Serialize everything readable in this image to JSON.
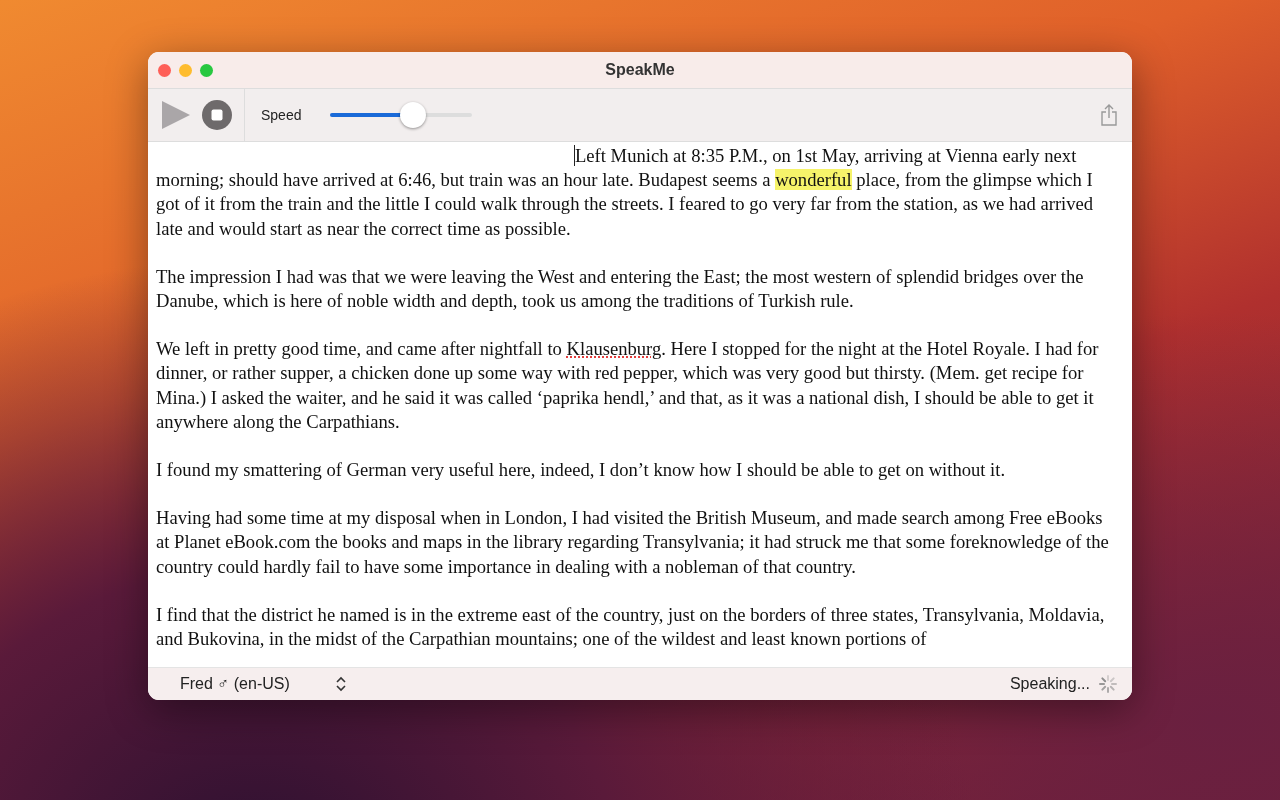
{
  "window": {
    "title": "SpeakMe"
  },
  "toolbar": {
    "speed_label": "Speed",
    "speed": {
      "level": 0.58
    }
  },
  "paragraphs": [
    {
      "kind": "cursor",
      "segments": [
        {
          "kind": "plain",
          "text": "Left Munich at 8:35 P.M., on 1st May, arriving at Vienna early next morning; should have arrived at 6:46, but train was an hour late. Budapest seems a "
        },
        {
          "kind": "highlight",
          "text": "wonderful"
        },
        {
          "kind": "plain",
          "text": " place, from the glimpse which I got of it from the train and the little I could walk through the streets. I feared to go very far from the station, as we had arrived late and would start as near the correct time as possible."
        }
      ]
    },
    {
      "kind": "plain",
      "segments": [
        {
          "kind": "plain",
          "text": "The impression I had was that we were leaving the West and entering the East; the most western of splendid bridges over the Danube, which is here of noble width and depth, took us among the traditions of Turkish rule."
        }
      ]
    },
    {
      "kind": "plain",
      "segments": [
        {
          "kind": "plain",
          "text": "We left in pretty good time, and came after nightfall to "
        },
        {
          "kind": "misspelled",
          "text": "Klausenburg"
        },
        {
          "kind": "plain",
          "text": ". Here I stopped for the night at the Hotel Royale. I had for dinner, or rather supper, a chicken done up some way with red pepper, which was very good but thirsty. (Mem. get recipe for Mina.) I asked the waiter, and he said it was called ‘paprika hendl,’ and that, as it was a national dish, I should be able to get it anywhere along the Carpathians."
        }
      ]
    },
    {
      "kind": "plain",
      "segments": [
        {
          "kind": "plain",
          "text": "I found my smattering of German very useful here, indeed, I don’t know how I should be able to get on without it."
        }
      ]
    },
    {
      "kind": "plain",
      "segments": [
        {
          "kind": "plain",
          "text": "Having had some time at my disposal when in London, I had visited the British Museum, and made search among Free eBooks at Planet eBook.com the books and maps in the library regarding Transylvania; it had struck me that some foreknowledge of the country could hardly fail to have some importance in dealing with a nobleman of that country."
        }
      ]
    },
    {
      "kind": "plain",
      "segments": [
        {
          "kind": "plain",
          "text": "I find that the district he named is in the extreme east of the country, just on the borders of three states, Transylvania, Moldavia, and Bukovina, in the midst of the Carpathian mountains; one of the wildest and least known portions of"
        }
      ]
    }
  ],
  "status_bar": {
    "voice": "Fred ♂ (en-US)",
    "status": "Speaking..."
  }
}
